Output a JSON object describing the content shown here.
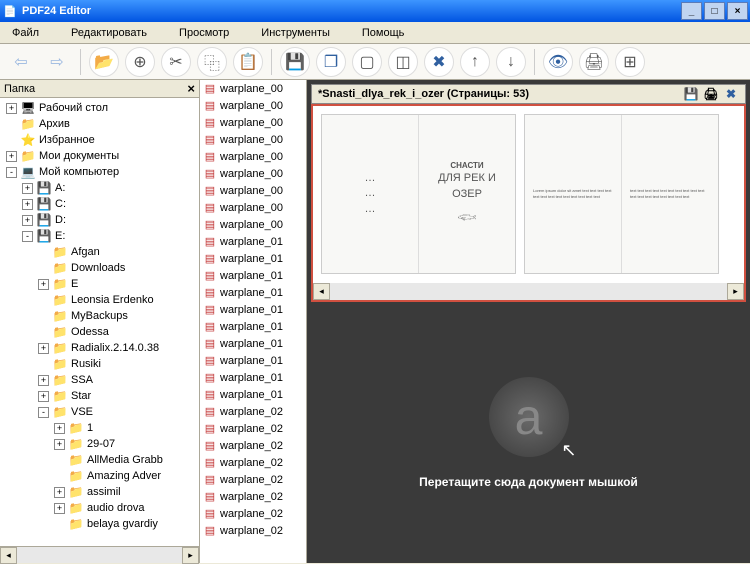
{
  "title": "PDF24 Editor",
  "menu": {
    "file": "Файл",
    "edit": "Редактировать",
    "view": "Просмотр",
    "tools": "Инструменты",
    "help": "Помощь"
  },
  "panel_folders_title": "Папка",
  "tree": [
    {
      "d": 0,
      "exp": "+",
      "icon": "🖥",
      "label": "Рабочий стол"
    },
    {
      "d": 0,
      "exp": "",
      "icon": "📁",
      "label": "Архив"
    },
    {
      "d": 0,
      "exp": "",
      "icon": "⭐",
      "label": "Избранное"
    },
    {
      "d": 0,
      "exp": "+",
      "icon": "📁",
      "label": "Мои документы"
    },
    {
      "d": 0,
      "exp": "-",
      "icon": "💻",
      "label": "Мой компьютер"
    },
    {
      "d": 1,
      "exp": "+",
      "icon": "💾",
      "label": "A:"
    },
    {
      "d": 1,
      "exp": "+",
      "icon": "💾",
      "label": "C:"
    },
    {
      "d": 1,
      "exp": "+",
      "icon": "💾",
      "label": "D:"
    },
    {
      "d": 1,
      "exp": "-",
      "icon": "💾",
      "label": "E:"
    },
    {
      "d": 2,
      "exp": "",
      "icon": "📁",
      "label": "Afgan"
    },
    {
      "d": 2,
      "exp": "",
      "icon": "📁",
      "label": "Downloads"
    },
    {
      "d": 2,
      "exp": "+",
      "icon": "📁",
      "label": "E"
    },
    {
      "d": 2,
      "exp": "",
      "icon": "📁",
      "label": "Leonsia Erdenko"
    },
    {
      "d": 2,
      "exp": "",
      "icon": "📁",
      "label": "MyBackups"
    },
    {
      "d": 2,
      "exp": "",
      "icon": "📁",
      "label": "Odessa"
    },
    {
      "d": 2,
      "exp": "+",
      "icon": "📁",
      "label": "Radialix.2.14.0.38"
    },
    {
      "d": 2,
      "exp": "",
      "icon": "📁",
      "label": "Rusiki"
    },
    {
      "d": 2,
      "exp": "+",
      "icon": "📁",
      "label": "SSA"
    },
    {
      "d": 2,
      "exp": "+",
      "icon": "📁",
      "label": "Star"
    },
    {
      "d": 2,
      "exp": "-",
      "icon": "📁",
      "label": "VSE"
    },
    {
      "d": 3,
      "exp": "+",
      "icon": "📁",
      "label": "1"
    },
    {
      "d": 3,
      "exp": "+",
      "icon": "📁",
      "label": "29-07"
    },
    {
      "d": 3,
      "exp": "",
      "icon": "📁",
      "label": "AllMedia Grabb"
    },
    {
      "d": 3,
      "exp": "",
      "icon": "📁",
      "label": "Amazing Adver"
    },
    {
      "d": 3,
      "exp": "+",
      "icon": "📁",
      "label": "assimil"
    },
    {
      "d": 3,
      "exp": "+",
      "icon": "📁",
      "label": "audio drova"
    },
    {
      "d": 3,
      "exp": "",
      "icon": "📁",
      "label": "belaya gvardiy"
    }
  ],
  "files": [
    "warplane_00",
    "warplane_00",
    "warplane_00",
    "warplane_00",
    "warplane_00",
    "warplane_00",
    "warplane_00",
    "warplane_00",
    "warplane_00",
    "warplane_01",
    "warplane_01",
    "warplane_01",
    "warplane_01",
    "warplane_01",
    "warplane_01",
    "warplane_01",
    "warplane_01",
    "warplane_01",
    "warplane_01",
    "warplane_02",
    "warplane_02",
    "warplane_02",
    "warplane_02",
    "warplane_02",
    "warplane_02",
    "warplane_02",
    "warplane_02"
  ],
  "doc": {
    "title": "*Snasti_dlya_rek_i_ozer (Страницы: 53)",
    "page_title": "СНАСТИ",
    "page_sub": "ДЛЯ РЕК И ОЗЕР"
  },
  "drop_text": "Перетащите сюда документ мышкой"
}
